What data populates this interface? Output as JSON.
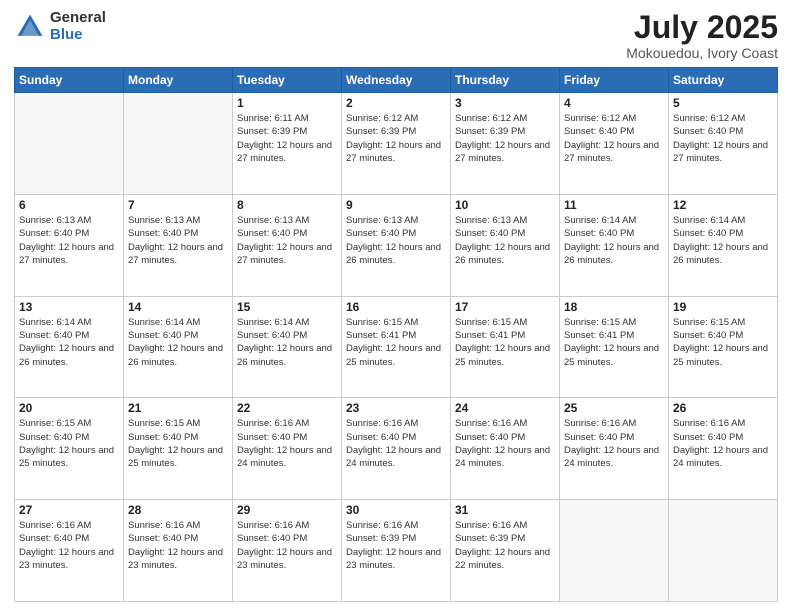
{
  "header": {
    "logo_general": "General",
    "logo_blue": "Blue",
    "title": "July 2025",
    "location": "Mokouedou, Ivory Coast"
  },
  "days_of_week": [
    "Sunday",
    "Monday",
    "Tuesday",
    "Wednesday",
    "Thursday",
    "Friday",
    "Saturday"
  ],
  "weeks": [
    [
      {
        "day": "",
        "info": ""
      },
      {
        "day": "",
        "info": ""
      },
      {
        "day": "1",
        "info": "Sunrise: 6:11 AM\nSunset: 6:39 PM\nDaylight: 12 hours and 27 minutes."
      },
      {
        "day": "2",
        "info": "Sunrise: 6:12 AM\nSunset: 6:39 PM\nDaylight: 12 hours and 27 minutes."
      },
      {
        "day": "3",
        "info": "Sunrise: 6:12 AM\nSunset: 6:39 PM\nDaylight: 12 hours and 27 minutes."
      },
      {
        "day": "4",
        "info": "Sunrise: 6:12 AM\nSunset: 6:40 PM\nDaylight: 12 hours and 27 minutes."
      },
      {
        "day": "5",
        "info": "Sunrise: 6:12 AM\nSunset: 6:40 PM\nDaylight: 12 hours and 27 minutes."
      }
    ],
    [
      {
        "day": "6",
        "info": "Sunrise: 6:13 AM\nSunset: 6:40 PM\nDaylight: 12 hours and 27 minutes."
      },
      {
        "day": "7",
        "info": "Sunrise: 6:13 AM\nSunset: 6:40 PM\nDaylight: 12 hours and 27 minutes."
      },
      {
        "day": "8",
        "info": "Sunrise: 6:13 AM\nSunset: 6:40 PM\nDaylight: 12 hours and 27 minutes."
      },
      {
        "day": "9",
        "info": "Sunrise: 6:13 AM\nSunset: 6:40 PM\nDaylight: 12 hours and 26 minutes."
      },
      {
        "day": "10",
        "info": "Sunrise: 6:13 AM\nSunset: 6:40 PM\nDaylight: 12 hours and 26 minutes."
      },
      {
        "day": "11",
        "info": "Sunrise: 6:14 AM\nSunset: 6:40 PM\nDaylight: 12 hours and 26 minutes."
      },
      {
        "day": "12",
        "info": "Sunrise: 6:14 AM\nSunset: 6:40 PM\nDaylight: 12 hours and 26 minutes."
      }
    ],
    [
      {
        "day": "13",
        "info": "Sunrise: 6:14 AM\nSunset: 6:40 PM\nDaylight: 12 hours and 26 minutes."
      },
      {
        "day": "14",
        "info": "Sunrise: 6:14 AM\nSunset: 6:40 PM\nDaylight: 12 hours and 26 minutes."
      },
      {
        "day": "15",
        "info": "Sunrise: 6:14 AM\nSunset: 6:40 PM\nDaylight: 12 hours and 26 minutes."
      },
      {
        "day": "16",
        "info": "Sunrise: 6:15 AM\nSunset: 6:41 PM\nDaylight: 12 hours and 25 minutes."
      },
      {
        "day": "17",
        "info": "Sunrise: 6:15 AM\nSunset: 6:41 PM\nDaylight: 12 hours and 25 minutes."
      },
      {
        "day": "18",
        "info": "Sunrise: 6:15 AM\nSunset: 6:41 PM\nDaylight: 12 hours and 25 minutes."
      },
      {
        "day": "19",
        "info": "Sunrise: 6:15 AM\nSunset: 6:40 PM\nDaylight: 12 hours and 25 minutes."
      }
    ],
    [
      {
        "day": "20",
        "info": "Sunrise: 6:15 AM\nSunset: 6:40 PM\nDaylight: 12 hours and 25 minutes."
      },
      {
        "day": "21",
        "info": "Sunrise: 6:15 AM\nSunset: 6:40 PM\nDaylight: 12 hours and 25 minutes."
      },
      {
        "day": "22",
        "info": "Sunrise: 6:16 AM\nSunset: 6:40 PM\nDaylight: 12 hours and 24 minutes."
      },
      {
        "day": "23",
        "info": "Sunrise: 6:16 AM\nSunset: 6:40 PM\nDaylight: 12 hours and 24 minutes."
      },
      {
        "day": "24",
        "info": "Sunrise: 6:16 AM\nSunset: 6:40 PM\nDaylight: 12 hours and 24 minutes."
      },
      {
        "day": "25",
        "info": "Sunrise: 6:16 AM\nSunset: 6:40 PM\nDaylight: 12 hours and 24 minutes."
      },
      {
        "day": "26",
        "info": "Sunrise: 6:16 AM\nSunset: 6:40 PM\nDaylight: 12 hours and 24 minutes."
      }
    ],
    [
      {
        "day": "27",
        "info": "Sunrise: 6:16 AM\nSunset: 6:40 PM\nDaylight: 12 hours and 23 minutes."
      },
      {
        "day": "28",
        "info": "Sunrise: 6:16 AM\nSunset: 6:40 PM\nDaylight: 12 hours and 23 minutes."
      },
      {
        "day": "29",
        "info": "Sunrise: 6:16 AM\nSunset: 6:40 PM\nDaylight: 12 hours and 23 minutes."
      },
      {
        "day": "30",
        "info": "Sunrise: 6:16 AM\nSunset: 6:39 PM\nDaylight: 12 hours and 23 minutes."
      },
      {
        "day": "31",
        "info": "Sunrise: 6:16 AM\nSunset: 6:39 PM\nDaylight: 12 hours and 22 minutes."
      },
      {
        "day": "",
        "info": ""
      },
      {
        "day": "",
        "info": ""
      }
    ]
  ]
}
